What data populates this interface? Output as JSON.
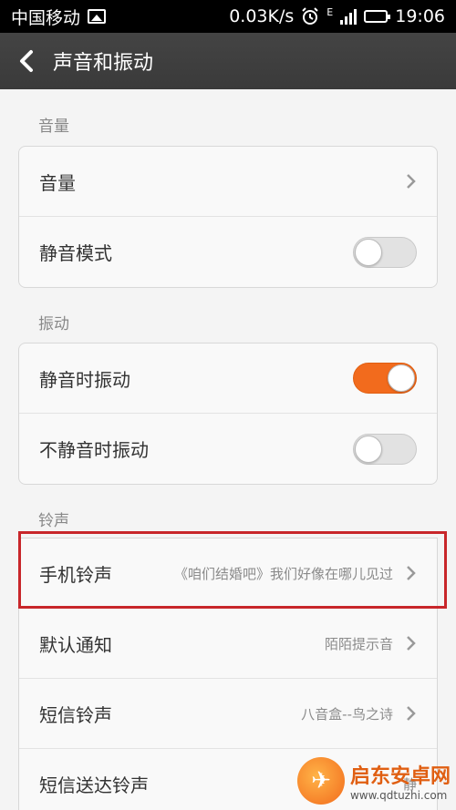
{
  "status_bar": {
    "carrier": "中国移动",
    "speed": "0.03K/s",
    "network": "E",
    "time": "19:06"
  },
  "header": {
    "title": "声音和振动"
  },
  "sections": {
    "volume": {
      "label": "音量",
      "rows": [
        {
          "label": "音量"
        },
        {
          "label": "静音模式",
          "toggle": false
        }
      ]
    },
    "vibration": {
      "label": "振动",
      "rows": [
        {
          "label": "静音时振动",
          "toggle": true
        },
        {
          "label": "不静音时振动",
          "toggle": false
        }
      ]
    },
    "ringtone": {
      "label": "铃声",
      "rows": [
        {
          "label": "手机铃声",
          "value": "《咱们结婚吧》我们好像在哪儿见过"
        },
        {
          "label": "默认通知",
          "value": "陌陌提示音"
        },
        {
          "label": "短信铃声",
          "value": "八音盒--鸟之诗"
        },
        {
          "label": "短信送达铃声",
          "value": "静"
        }
      ]
    }
  },
  "watermark": {
    "title": "启东安卓网",
    "url": "www.qdtuzhi.com"
  },
  "colors": {
    "accent": "#f26b1d",
    "highlight": "#c8262a"
  }
}
